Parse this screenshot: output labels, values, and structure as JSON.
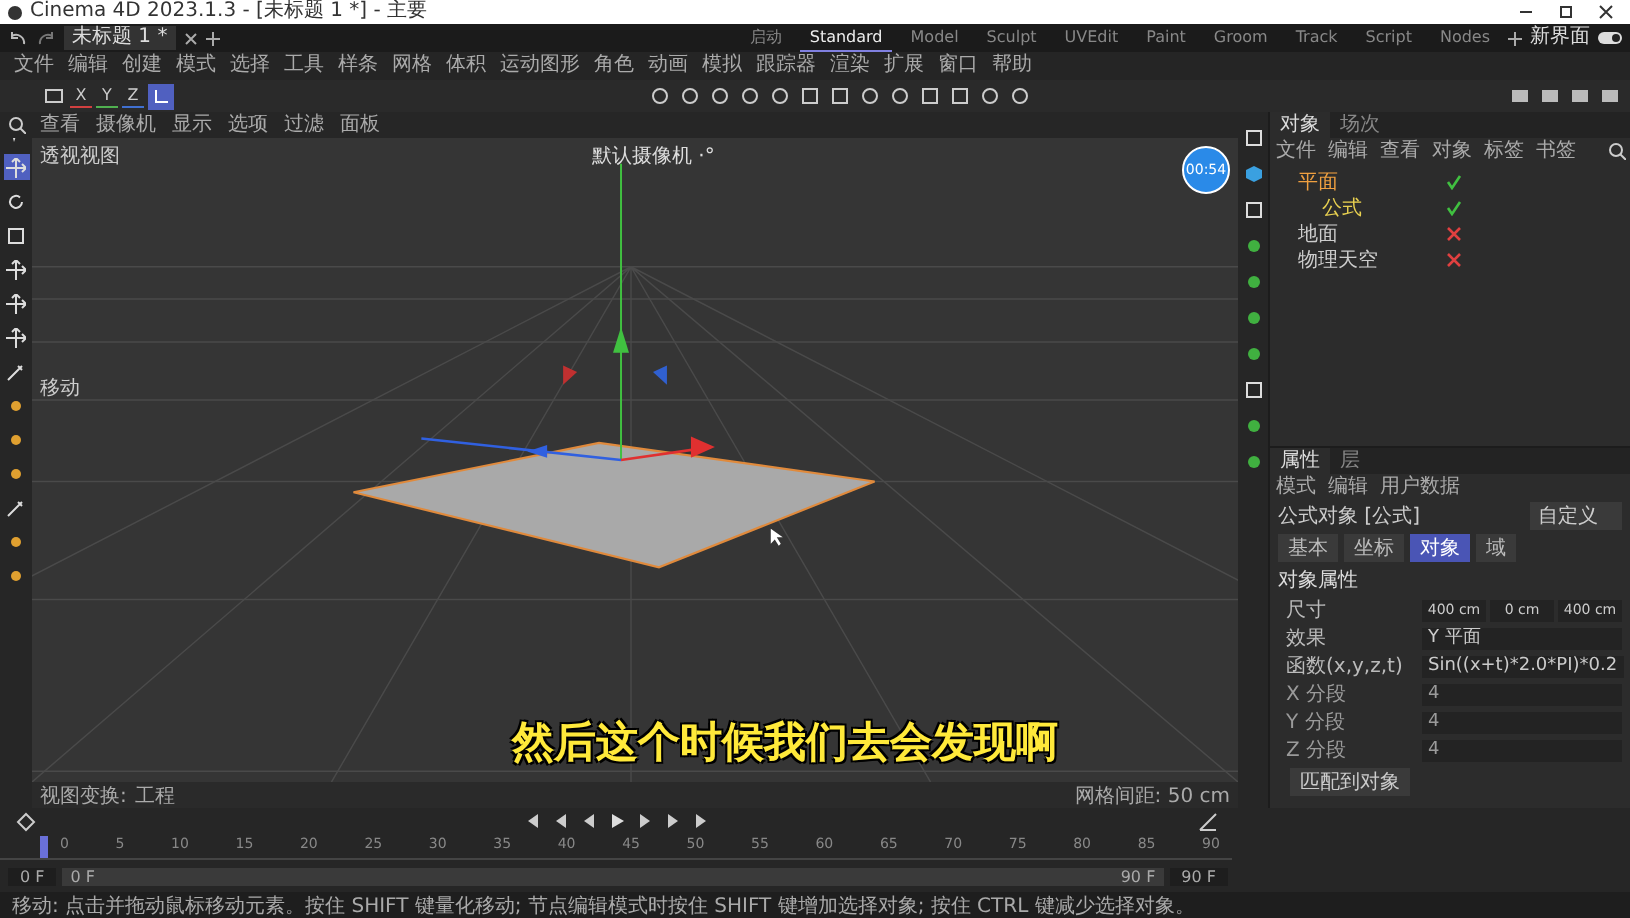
{
  "window": {
    "title": "Cinema 4D 2023.1.3 - [未标题 1 *] - 主要"
  },
  "document_tabs": [
    {
      "label": "未标题 1 *",
      "selected": true
    }
  ],
  "layouts": [
    {
      "label": "启动",
      "selected": false
    },
    {
      "label": "Standard",
      "selected": true
    },
    {
      "label": "Model",
      "selected": false
    },
    {
      "label": "Sculpt",
      "selected": false
    },
    {
      "label": "UVEdit",
      "selected": false
    },
    {
      "label": "Paint",
      "selected": false
    },
    {
      "label": "Groom",
      "selected": false
    },
    {
      "label": "Track",
      "selected": false
    },
    {
      "label": "Script",
      "selected": false
    },
    {
      "label": "Nodes",
      "selected": false
    }
  ],
  "new_layout": {
    "label": "新界面",
    "on": true
  },
  "menu": [
    "文件",
    "编辑",
    "创建",
    "模式",
    "选择",
    "工具",
    "样条",
    "网格",
    "体积",
    "运动图形",
    "角色",
    "动画",
    "模拟",
    "跟踪器",
    "渲染",
    "扩展",
    "窗口",
    "帮助"
  ],
  "axis_toggles": [
    {
      "label": "X",
      "color": "#d04040"
    },
    {
      "label": "Y",
      "color": "#50b050"
    },
    {
      "label": "Z",
      "color": "#4070d0"
    }
  ],
  "viewport": {
    "menu": [
      "查看",
      "摄像机",
      "显示",
      "选项",
      "过滤",
      "面板"
    ],
    "name": "透视视图",
    "camera": "默认摄像机 ·°",
    "tool_label": "移动",
    "timer": "00:54",
    "transform_label": "视图变换:",
    "transform_value": "工程",
    "grid_spacing": "网格间距: 50 cm"
  },
  "object_manager": {
    "tabs": [
      {
        "label": "对象",
        "selected": true
      },
      {
        "label": "场次",
        "selected": false
      }
    ],
    "menu": [
      "文件",
      "编辑",
      "查看",
      "对象",
      "标签",
      "书签"
    ],
    "objects": [
      {
        "name": "平面",
        "selected": true,
        "enabled": true,
        "children": [
          {
            "name": "公式",
            "selected": true,
            "enabled": true
          }
        ]
      },
      {
        "name": "地面",
        "selected": false,
        "enabled": false
      },
      {
        "name": "物理天空",
        "selected": false,
        "enabled": false
      }
    ]
  },
  "attributes": {
    "tabs": [
      {
        "label": "属性",
        "selected": true
      },
      {
        "label": "层",
        "selected": false
      }
    ],
    "menu": [
      "模式",
      "编辑",
      "用户数据"
    ],
    "object_title": "公式对象 [公式]",
    "preset": "自定义",
    "sub_tabs": [
      {
        "label": "基本",
        "selected": false
      },
      {
        "label": "坐标",
        "selected": false
      },
      {
        "label": "对象",
        "selected": true
      },
      {
        "label": "域",
        "selected": false
      }
    ],
    "section": "对象属性",
    "rows": [
      {
        "kind": "vector",
        "label": "尺寸",
        "values": [
          "400 cm",
          "0 cm",
          "400 cm"
        ],
        "disabled": false
      },
      {
        "kind": "dropdown",
        "label": "效果",
        "value": "Y 平面",
        "disabled": false
      },
      {
        "kind": "text",
        "label": "函数(x,y,z,t)",
        "value": "Sin((x+t)*2.0*PI)*0.2",
        "disabled": false
      },
      {
        "kind": "text",
        "label": "X 分段",
        "value": "4",
        "disabled": true
      },
      {
        "kind": "text",
        "label": "Y 分段",
        "value": "4",
        "disabled": true
      },
      {
        "kind": "text",
        "label": "Z 分段",
        "value": "4",
        "disabled": true
      }
    ],
    "button": "匹配到对象"
  },
  "timeline": {
    "ticks": [
      "0",
      "5",
      "10",
      "15",
      "20",
      "25",
      "30",
      "35",
      "40",
      "45",
      "50",
      "55",
      "60",
      "65",
      "70",
      "75",
      "80",
      "85",
      "90"
    ],
    "start": "0 F",
    "range_start": "0 F",
    "range_end": "90 F",
    "end": "90 F",
    "level": 1
  },
  "subtitle": "然后这个时候我们去会发现啊",
  "status_bar": "移动: 点击并拖动鼠标移动元素。按住 SHIFT 键量化移动; 节点编辑模式时按住 SHIFT 键增加选择对象; 按住 CTRL 键减少选择对象。"
}
